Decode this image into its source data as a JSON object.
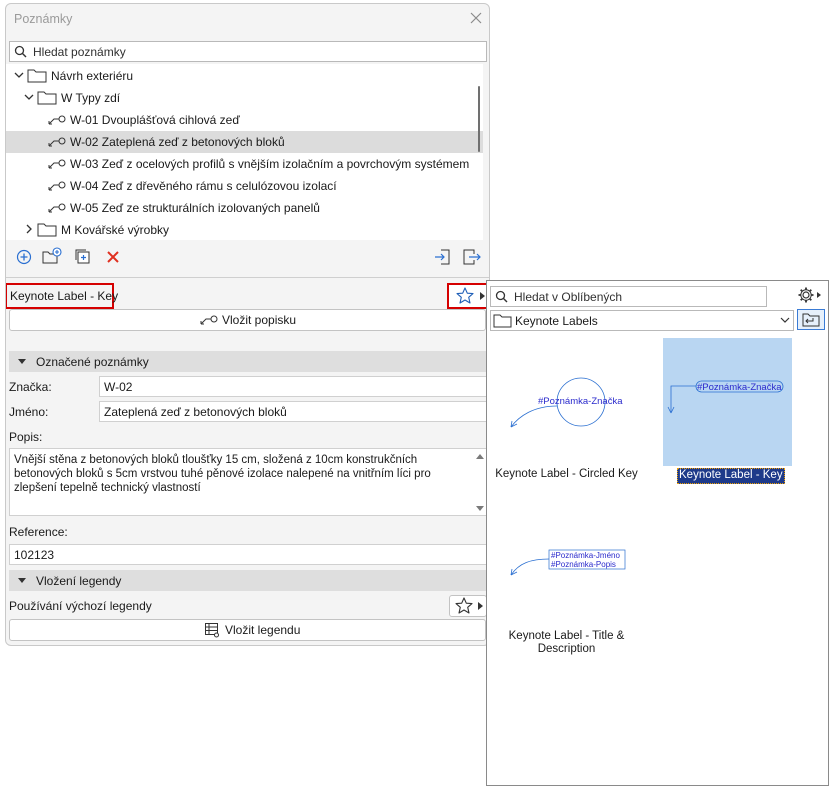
{
  "palette": {
    "title": "Poznámky",
    "search_placeholder": "Hledat poznámky",
    "tree": [
      {
        "label": "Návrh exteriéru",
        "kind": "folder"
      },
      {
        "label": "W Typy zdí",
        "kind": "folder"
      },
      {
        "label": "W-01 Dvouplášťová cihlová zeď",
        "kind": "keynote"
      },
      {
        "label": "W-02 Zateplená zeď z betonových bloků",
        "kind": "keynote",
        "selected": true
      },
      {
        "label": "W-03 Zeď z ocelových profilů s vnějším izolačním a povrchovým systémem",
        "kind": "keynote"
      },
      {
        "label": "W-04 Zeď z dřevěného rámu s celulózovou izolací",
        "kind": "keynote"
      },
      {
        "label": "W-05 Zeď ze strukturálních izolovaných panelů",
        "kind": "keynote"
      },
      {
        "label": "M Kovářské výrobky",
        "kind": "folder"
      }
    ],
    "label_style": "Keynote Label - Key",
    "insert_label_btn": "Vložit popisku",
    "marked_section": "Označené poznámky",
    "tag_label": "Značka:",
    "tag_value": "W-02",
    "name_label": "Jméno:",
    "name_value": "Zateplená zeď z betonových bloků",
    "desc_label": "Popis:",
    "desc_lines": [
      "Vnější stěna z betonových bloků tloušťky 15 cm, složená z 10cm konstrukčních",
      "betonových bloků s 5cm vrstvou tuhé pěnové izolace nalepené na vnitřním líci pro",
      "zlepšení tepelně technický vlastností"
    ],
    "ref_label": "Reference:",
    "ref_value": "102123",
    "legend_section": "Vložení legendy",
    "legend_default": "Používání výchozí legendy",
    "insert_legend_btn": "Vložit legendu"
  },
  "favorites": {
    "search_placeholder": "Hledat v Oblíbených",
    "folder": "Keynote Labels",
    "items": [
      {
        "name": "Keynote Label - Circled Key",
        "preview": [
          "#Poznámka-Značka"
        ]
      },
      {
        "name": "Keynote Label - Key",
        "preview": [
          "#Poznámka-Značka"
        ],
        "selected": true
      },
      {
        "name_lines": [
          "Keynote Label - Title &",
          "Description"
        ],
        "preview": [
          "#Poznámka-Jméno",
          "#Poznámka-Popis"
        ]
      }
    ]
  },
  "colors": {
    "highlight": "#d50000",
    "selection": "#b9d6f2",
    "preview_text": "#2a2acc",
    "delete": "#e03020",
    "accent": "#2a6fd1"
  }
}
